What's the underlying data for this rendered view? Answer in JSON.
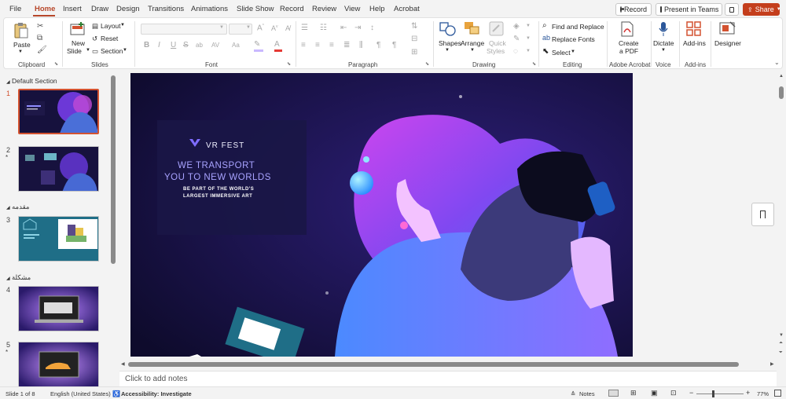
{
  "tabs": [
    "File",
    "Home",
    "Insert",
    "Draw",
    "Design",
    "Transitions",
    "Animations",
    "Slide Show",
    "Record",
    "Review",
    "View",
    "Help",
    "Acrobat"
  ],
  "active_tab": "Home",
  "top_buttons": {
    "record": "Record",
    "present_teams": "Present in Teams",
    "share": "Share"
  },
  "ribbon": {
    "clipboard": {
      "paste": "Paste",
      "label": "Clipboard"
    },
    "slides": {
      "new_slide_1": "New",
      "new_slide_2": "Slide",
      "layout": "Layout",
      "reset": "Reset",
      "section": "Section",
      "label": "Slides"
    },
    "font": {
      "label": "Font",
      "buttons": [
        "B",
        "I",
        "U",
        "S",
        "ab",
        "AV",
        "Aa",
        "A"
      ]
    },
    "paragraph": {
      "label": "Paragraph"
    },
    "drawing": {
      "shapes": "Shapes",
      "arrange": "Arrange",
      "quick_styles_1": "Quick",
      "quick_styles_2": "Styles",
      "label": "Drawing"
    },
    "editing": {
      "find_replace": "Find and Replace",
      "replace_fonts": "Replace Fonts",
      "select": "Select",
      "label": "Editing"
    },
    "acrobat": {
      "create_pdf_1": "Create",
      "create_pdf_2": "a PDF",
      "label": "Adobe Acrobat"
    },
    "voice": {
      "dictate": "Dictate",
      "label": "Voice"
    },
    "addins": {
      "addins": "Add-ins",
      "label": "Add-ins"
    },
    "designer": {
      "designer": "Designer"
    }
  },
  "thumbnails": {
    "sections": [
      "Default Section",
      "مقدمه",
      "مشكلة"
    ],
    "slides": [
      "1",
      "2",
      "3",
      "4",
      "5"
    ],
    "slide3_text": "Proper Solution"
  },
  "slide": {
    "brand": "VR FEST",
    "headline_1": "WE TRANSPORT",
    "headline_2": "YOU TO NEW WORLDS",
    "sub_1": "BE PART OF THE WORLD'S",
    "sub_2": "LARGEST IMMERSIVE ART"
  },
  "notes_placeholder": "Click to add notes",
  "status": {
    "slide_of": "Slide 1 of 8",
    "language": "English (United States)",
    "accessibility": "Accessibility: Investigate",
    "notes": "Notes",
    "zoom": "77%"
  },
  "colors": {
    "accent": "#b7472a",
    "share": "#c43e1c",
    "slide_bg": "#14103a",
    "selected_border": "#d35230"
  }
}
